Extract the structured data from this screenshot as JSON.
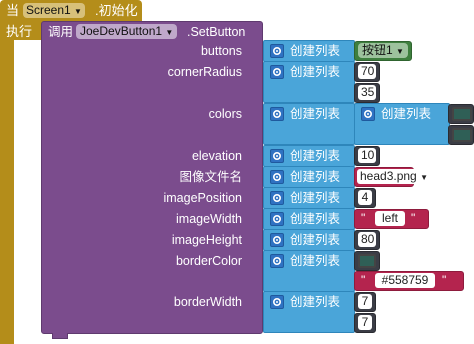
{
  "event": {
    "when_label": "当",
    "component": "Screen1",
    "event_name": ".初始化",
    "do_label": "执行"
  },
  "call": {
    "call_label": "调用",
    "component": "JoeDevButton1",
    "method": ".SetButton"
  },
  "params": [
    "buttons",
    "cornerRadius",
    "colors",
    "elevation",
    "图像文件名",
    "imagePosition",
    "imageWidth",
    "imageHeight",
    "borderColor",
    "borderWidth"
  ],
  "list_label": "创建列表",
  "values": {
    "buttons_item": "按钮1",
    "cornerRadius": [
      "70",
      "35"
    ],
    "elevation": "10",
    "image_file": "head3.png",
    "imagePosition": "4",
    "imageWidth_text": "left",
    "imageHeight": "80",
    "borderColor_text": "#558759",
    "borderWidth": [
      "7",
      "7"
    ]
  },
  "quote": "\"",
  "colors": {
    "event_gold": "#b48d1a",
    "call_purple": "#7b4c8d",
    "list_blue": "#4aa5d9",
    "text_red": "#b4244e",
    "component_green": "#3e7f3e",
    "color_swatch": "#2f5f56",
    "border_color_value": "#558759"
  }
}
